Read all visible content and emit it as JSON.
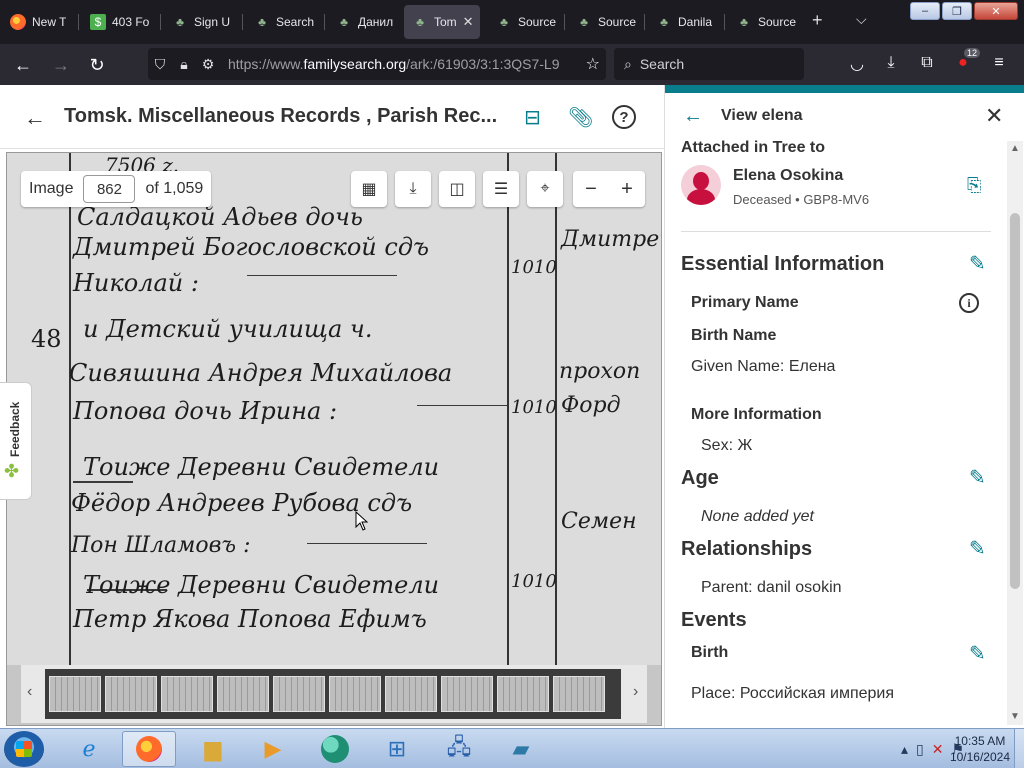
{
  "browser": {
    "tabs": [
      {
        "title": "New T",
        "icon": "firefox-icon",
        "active": false
      },
      {
        "title": "403 Fo",
        "icon": "money-icon",
        "active": false
      },
      {
        "title": "Sign U",
        "icon": "tree-icon",
        "active": false
      },
      {
        "title": "Search",
        "icon": "tree-icon",
        "active": false
      },
      {
        "title": "Данил",
        "icon": "tree-icon",
        "active": false
      },
      {
        "title": "Tom",
        "icon": "tree-icon",
        "active": true
      },
      {
        "title": "Source",
        "icon": "tree-icon",
        "active": false
      },
      {
        "title": "Source",
        "icon": "tree-icon",
        "active": false
      },
      {
        "title": "Danila",
        "icon": "tree-icon",
        "active": false
      },
      {
        "title": "Source",
        "icon": "tree-icon",
        "active": false
      }
    ],
    "window_controls": {
      "minimize": "–",
      "restore": "❐",
      "close": "✕"
    },
    "url_prefix": "https://www.",
    "url_domain": "familysearch.org",
    "url_rest": "/ark:/61903/3:1:3QS7-L9",
    "search_placeholder": "Search",
    "extension_badge": "12"
  },
  "page": {
    "title": "Tomsk. Miscellaneous Records , Parish Rec...",
    "viewer": {
      "image_label": "Image",
      "image_number": "862",
      "image_total": "of 1,059",
      "zoom_out": "−",
      "zoom_in": "+",
      "feedback_label": "Feedback",
      "record_number": "48",
      "script_lines": [
        "7506 z.",
        "Салдацкой   Адьев   дочь",
        "Дмитрей   Богословской   сдъ",
        "Николай :",
        "и   Детский   училища   ч.",
        "Сивяшина   Андрея   Михайлова",
        "Попова   дочь   Ирина :",
        "Тоиже   Деревни   Свидетели",
        "Фёдор   Андреев   Рубова   сдъ",
        "Пон   Шламовъ :",
        "Тоиже   Деревни   Свидетели",
        "Петр   Якова   Попова   Ефимъ",
        "1010",
        "1010",
        "1010",
        "Дмитрей",
        "прохоп",
        "Форд",
        "Семен"
      ]
    }
  },
  "panel": {
    "header_title": "View elena",
    "attached_label": "Attached in Tree to",
    "person": {
      "name": "Elena Osokina",
      "meta": "Deceased • GBP8-MV6"
    },
    "essential_title": "Essential Information",
    "primary_name_label": "Primary Name",
    "birth_name_label": "Birth Name",
    "given_name": "Given Name: Елена",
    "more_info_label": "More Information",
    "sex": "Sex: Ж",
    "age_title": "Age",
    "age_value": "None added yet",
    "relationships_title": "Relationships",
    "parent": "Parent: danil osokin",
    "events_title": "Events",
    "birth_label": "Birth",
    "place": "Place: Российская империя"
  },
  "taskbar": {
    "items": [
      "internet-explorer-icon",
      "firefox-icon",
      "folder-icon",
      "media-player-icon",
      "app-icon",
      "control-panel-icon",
      "network-icon",
      "tablet-icon"
    ],
    "time": "10:35 AM",
    "date": "10/16/2024"
  },
  "colors": {
    "accent": "#0a7d8c",
    "browser_dark": "#1c1b22",
    "avatar_red": "#c8103e"
  }
}
